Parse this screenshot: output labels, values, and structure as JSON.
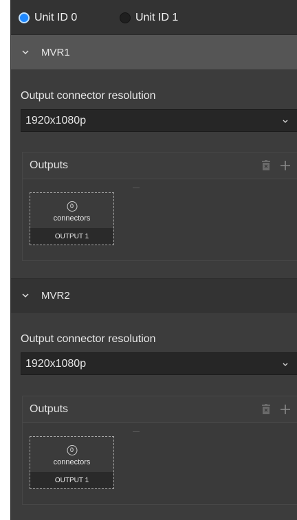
{
  "units": [
    {
      "label": "Unit ID 0",
      "checked": true
    },
    {
      "label": "Unit ID 1",
      "checked": false
    }
  ],
  "sections": [
    {
      "title": "MVR1",
      "resolution_label": "Output connector resolution",
      "resolution_value": "1920x1080p",
      "outputs_title": "Outputs",
      "outputs": [
        {
          "count": "0",
          "connectors_label": "connectors",
          "name": "OUTPUT 1"
        }
      ]
    },
    {
      "title": "MVR2",
      "resolution_label": "Output connector resolution",
      "resolution_value": "1920x1080p",
      "outputs_title": "Outputs",
      "outputs": [
        {
          "count": "0",
          "connectors_label": "connectors",
          "name": "OUTPUT 1"
        }
      ]
    }
  ],
  "icons": {
    "chevron": "chevron-down-icon",
    "delete": "trash-icon",
    "add": "plus-icon"
  },
  "colors": {
    "accent": "#1e88ff",
    "panel": "#3c3c3c",
    "header_active": "#555555",
    "header": "#333333"
  }
}
